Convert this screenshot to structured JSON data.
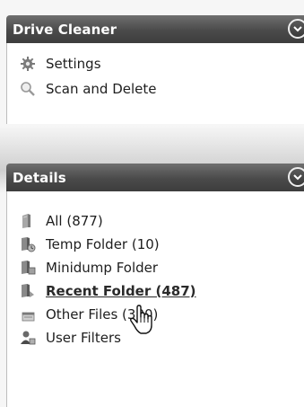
{
  "panels": {
    "drive_cleaner": {
      "title": "Drive Cleaner",
      "items": [
        {
          "label": "Settings",
          "icon": "gear-icon"
        },
        {
          "label": "Scan and Delete",
          "icon": "magnifier-icon"
        }
      ]
    },
    "details": {
      "title": "Details",
      "items": [
        {
          "label": "All (877)",
          "icon": "book-icon"
        },
        {
          "label": "Temp Folder (10)",
          "icon": "temp-folder-icon"
        },
        {
          "label": "Minidump Folder",
          "icon": "minidump-icon"
        },
        {
          "label": "Recent Folder (487)",
          "icon": "recent-folder-icon"
        },
        {
          "label": "Other Files (380)",
          "icon": "file-icon"
        },
        {
          "label": "User Filters",
          "icon": "user-icon"
        }
      ]
    }
  },
  "colors": {
    "header": "#4a4a4a",
    "header_text": "#ffffff",
    "panel_bg": "#ffffff",
    "text": "#1e1e1e"
  }
}
